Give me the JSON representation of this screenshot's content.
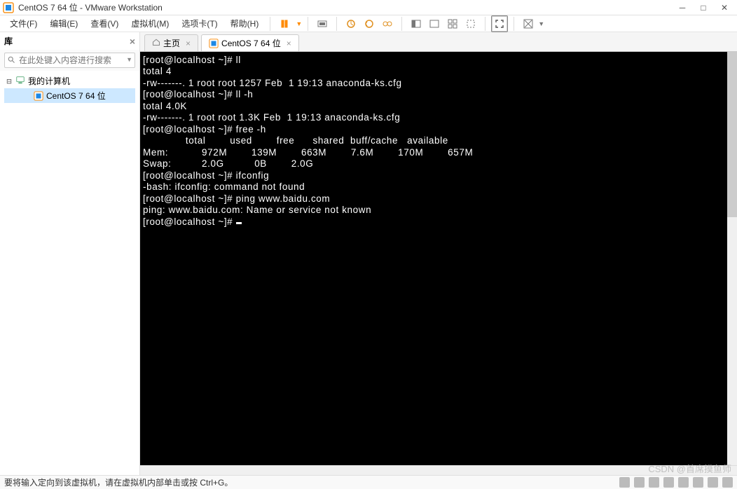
{
  "title": "CentOS 7 64 位 - VMware Workstation",
  "menus": {
    "file": "文件(F)",
    "edit": "编辑(E)",
    "view": "查看(V)",
    "vm": "虚拟机(M)",
    "tabs": "选项卡(T)",
    "help": "帮助(H)"
  },
  "sidebar": {
    "title": "库",
    "search_placeholder": "在此处键入内容进行搜索",
    "root": "我的计算机",
    "vm_name": "CentOS 7 64 位"
  },
  "tabs": {
    "home": "主页",
    "vm": "CentOS 7 64 位"
  },
  "terminal": {
    "lines": [
      "[root@localhost ~]# ll",
      "total 4",
      "-rw-------. 1 root root 1257 Feb  1 19:13 anaconda-ks.cfg",
      "[root@localhost ~]# ll -h",
      "total 4.0K",
      "-rw-------. 1 root root 1.3K Feb  1 19:13 anaconda-ks.cfg",
      "[root@localhost ~]# free -h",
      "              total        used        free      shared  buff/cache   available",
      "Mem:           972M        139M        663M        7.6M        170M        657M",
      "Swap:          2.0G          0B        2.0G",
      "[root@localhost ~]# ifconfig",
      "-bash: ifconfig: command not found",
      "[root@localhost ~]# ping www.baidu.com",
      "ping: www.baidu.com: Name or service not known",
      "[root@localhost ~]# "
    ]
  },
  "statusbar": {
    "hint": "要将输入定向到该虚拟机，请在虚拟机内部单击或按 Ctrl+G。"
  },
  "watermark": "CSDN @首席摸鱼师"
}
